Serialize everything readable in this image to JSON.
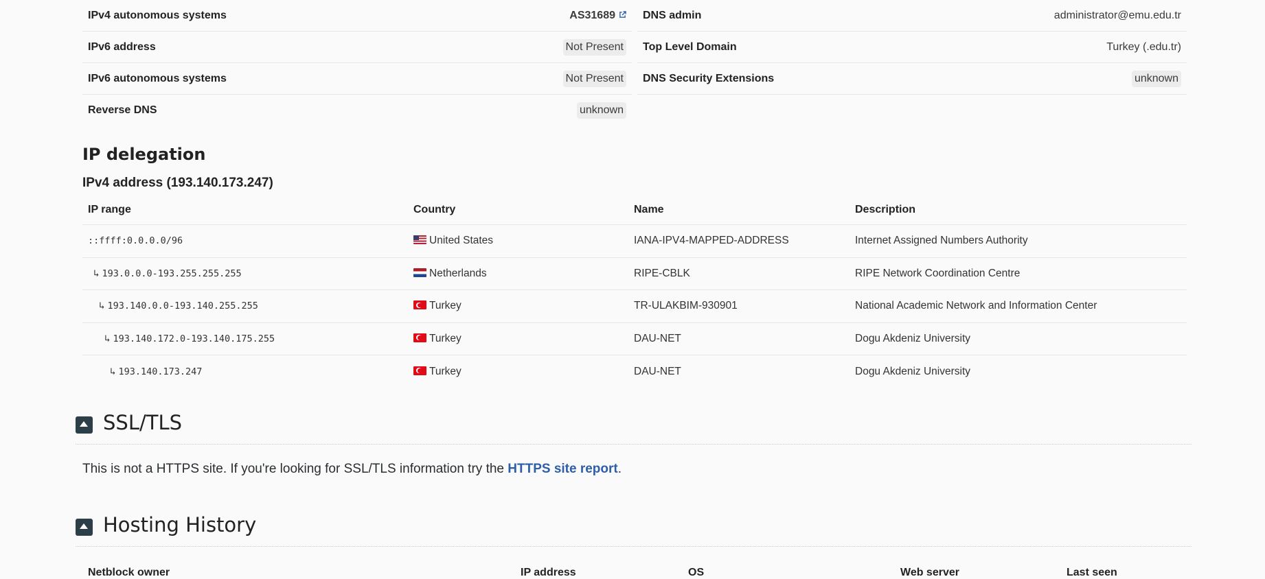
{
  "info_left": [
    {
      "key": "IPv4 autonomous systems",
      "value": "AS31689",
      "type": "link"
    },
    {
      "key": "IPv6 address",
      "value": "Not Present",
      "type": "pill"
    },
    {
      "key": "IPv6 autonomous systems",
      "value": "Not Present",
      "type": "pill"
    },
    {
      "key": "Reverse DNS",
      "value": "unknown",
      "type": "pill"
    }
  ],
  "info_right": [
    {
      "key": "DNS admin",
      "value": "administrator@emu.edu.tr",
      "type": "text"
    },
    {
      "key": "Top Level Domain",
      "value": "Turkey (.edu.tr)",
      "type": "text"
    },
    {
      "key": "DNS Security Extensions",
      "value": "unknown",
      "type": "pill"
    }
  ],
  "ip_delegation": {
    "title": "IP delegation",
    "subtitle": "IPv4 address (193.140.173.247)",
    "headers": [
      "IP range",
      "Country",
      "Name",
      "Description"
    ],
    "rows": [
      {
        "range": "::ffff:0.0.0.0/96",
        "indent": 0,
        "flag": "us",
        "country": "United States",
        "name": "IANA-IPV4-MAPPED-ADDRESS",
        "description": "Internet Assigned Numbers Authority"
      },
      {
        "range": "193.0.0.0-193.255.255.255",
        "indent": 1,
        "flag": "nl",
        "country": "Netherlands",
        "name": "RIPE-CBLK",
        "description": "RIPE Network Coordination Centre"
      },
      {
        "range": "193.140.0.0-193.140.255.255",
        "indent": 2,
        "flag": "tr",
        "country": "Turkey",
        "name": "TR-ULAKBIM-930901",
        "description": "National Academic Network and Information Center"
      },
      {
        "range": "193.140.172.0-193.140.175.255",
        "indent": 3,
        "flag": "tr",
        "country": "Turkey",
        "name": "DAU-NET",
        "description": "Dogu Akdeniz University"
      },
      {
        "range": "193.140.173.247",
        "indent": 4,
        "flag": "tr",
        "country": "Turkey",
        "name": "DAU-NET",
        "description": "Dogu Akdeniz University"
      }
    ],
    "arrow": "↳"
  },
  "ssl": {
    "title": "SSL/TLS",
    "text_before": "This is not a HTTPS site. If you're looking for SSL/TLS information try the ",
    "link": "HTTPS site report",
    "text_after": "."
  },
  "hosting": {
    "title": "Hosting History",
    "headers": [
      "Netblock owner",
      "IP address",
      "OS",
      "Web server",
      "Last seen"
    ]
  },
  "colors": {
    "link": "#2e5ea8",
    "toggle": "#2c3e48"
  }
}
